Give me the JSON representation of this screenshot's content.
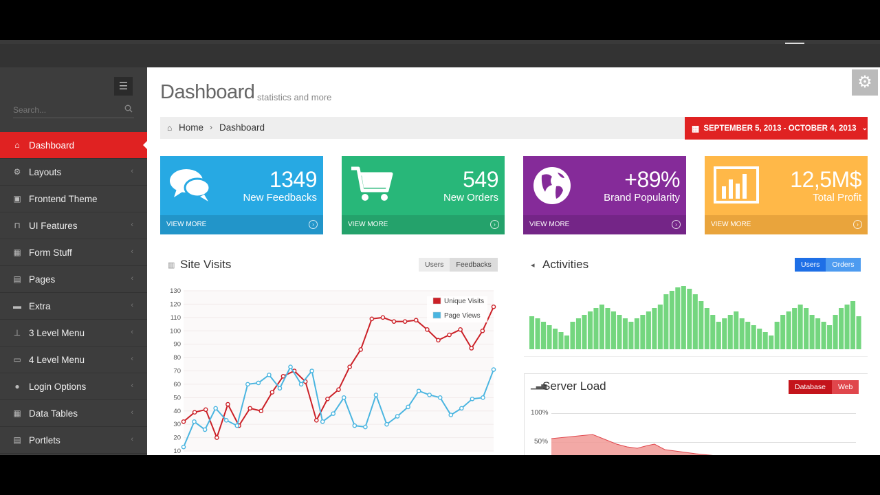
{
  "sidebar": {
    "search_placeholder": "Search...",
    "items": [
      {
        "label": "Dashboard",
        "icon": "home-icon",
        "active": true
      },
      {
        "label": "Layouts",
        "icon": "cogs-icon"
      },
      {
        "label": "Frontend Theme",
        "icon": "gift-icon"
      },
      {
        "label": "UI Features",
        "icon": "bookmark-icon"
      },
      {
        "label": "Form Stuff",
        "icon": "table-icon"
      },
      {
        "label": "Pages",
        "icon": "briefcase-icon"
      },
      {
        "label": "Extra",
        "icon": "folder-icon"
      },
      {
        "label": "3 Level Menu",
        "icon": "sitemap-icon"
      },
      {
        "label": "4 Level Menu",
        "icon": "folder-open-icon"
      },
      {
        "label": "Login Options",
        "icon": "user-icon"
      },
      {
        "label": "Data Tables",
        "icon": "th-icon"
      },
      {
        "label": "Portlets",
        "icon": "briefcase-icon"
      }
    ]
  },
  "page": {
    "title": "Dashboard",
    "subtitle": "statistics and more"
  },
  "breadcrumb": {
    "home": "Home",
    "current": "Dashboard"
  },
  "daterange": {
    "label": "SEPTEMBER 5, 2013 - OCTOBER 4, 2013"
  },
  "stats": [
    {
      "number": "1349",
      "desc": "New Feedbacks",
      "more": "VIEW MORE",
      "color": "#27a9e3",
      "footer": "#2295c9",
      "icon": "comments-icon"
    },
    {
      "number": "549",
      "desc": "New Orders",
      "more": "VIEW MORE",
      "color": "#28b779",
      "footer": "#24a26b",
      "icon": "shopping-cart-icon"
    },
    {
      "number": "+89%",
      "desc": "Brand Popularity",
      "more": "VIEW MORE",
      "color": "#852b99",
      "footer": "#742587",
      "icon": "globe-icon"
    },
    {
      "number": "12,5M$",
      "desc": "Total Profit",
      "more": "VIEW MORE",
      "color": "#ffb848",
      "footer": "#e9a43c",
      "icon": "bar-chart-icon"
    }
  ],
  "site_visits": {
    "title": "Site Visits",
    "tabs": [
      "Users",
      "Feedbacks"
    ]
  },
  "activities": {
    "title": "Activities",
    "tabs": [
      "Users",
      "Orders"
    ]
  },
  "server_load": {
    "title": "Server Load",
    "tabs": [
      "Database",
      "Web"
    ],
    "y_labels": [
      "100%",
      "50%"
    ]
  },
  "chart_data": [
    {
      "type": "line",
      "title": "Site Visits",
      "ylim": [
        10,
        130
      ],
      "yticks": [
        130,
        120,
        110,
        100,
        90,
        80,
        70,
        60,
        50,
        40,
        30,
        20,
        10
      ],
      "series": [
        {
          "name": "Unique Visits",
          "color": "#cb2027",
          "values": [
            32,
            39,
            41,
            20,
            45,
            29,
            42,
            40,
            54,
            66,
            70,
            62,
            33,
            49,
            56,
            73,
            86,
            109,
            110,
            107,
            107,
            108,
            101,
            93,
            97,
            101,
            87,
            100,
            118
          ]
        },
        {
          "name": "Page Views",
          "color": "#4ab5e0",
          "values": [
            13,
            32,
            26,
            42,
            33,
            29,
            60,
            61,
            67,
            57,
            73,
            60,
            70,
            32,
            38,
            50,
            29,
            28,
            52,
            30,
            36,
            43,
            55,
            52,
            50,
            37,
            42,
            49,
            50,
            71
          ]
        }
      ]
    },
    {
      "type": "bar",
      "title": "Activities",
      "values": [
        48,
        45,
        40,
        35,
        30,
        25,
        20,
        40,
        45,
        50,
        55,
        60,
        65,
        60,
        55,
        50,
        45,
        40,
        45,
        50,
        55,
        60,
        65,
        80,
        85,
        90,
        92,
        88,
        80,
        70,
        60,
        50,
        40,
        45,
        50,
        55,
        45,
        40,
        35,
        30,
        25,
        20,
        40,
        50,
        55,
        60,
        65,
        60,
        50,
        45,
        40,
        35,
        50,
        60,
        65,
        70,
        48
      ]
    }
  ]
}
